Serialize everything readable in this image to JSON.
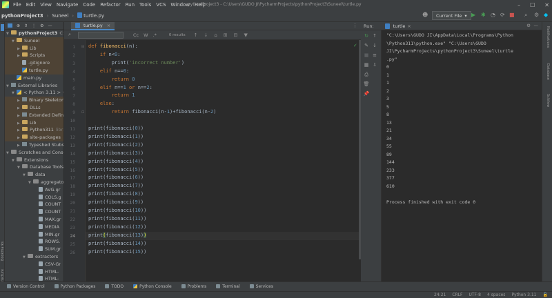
{
  "menu": [
    "File",
    "Edit",
    "View",
    "Navigate",
    "Code",
    "Refactor",
    "Run",
    "Tools",
    "VCS",
    "Window",
    "Help"
  ],
  "window_path": "pythonProject3 - C:\\Users\\GUDO JI\\PycharmProjects\\pythonProject3\\Suneel\\turtle.py",
  "breadcrumbs": [
    "pythonProject3",
    "Suneel",
    "turtle.py"
  ],
  "run_config": "Current File",
  "project_panel": {
    "label": "Project",
    "tree": [
      {
        "label": "pythonProject3",
        "suffix": "C:\\Use",
        "indent": 0,
        "arrow": "down",
        "icon": "folder",
        "bold": true
      },
      {
        "label": "Suneel",
        "indent": 1,
        "arrow": "down",
        "icon": "folder",
        "sel": true
      },
      {
        "label": "Lib",
        "indent": 2,
        "arrow": "right",
        "icon": "folder",
        "sel": true
      },
      {
        "label": "Scripts",
        "indent": 2,
        "arrow": "right",
        "icon": "folder",
        "sel": true
      },
      {
        "label": ".gitignore",
        "indent": 2,
        "arrow": "",
        "icon": "file",
        "sel": true
      },
      {
        "label": "turtle.py",
        "indent": 2,
        "arrow": "",
        "icon": "python",
        "sel": true
      },
      {
        "label": "main.py",
        "indent": 1,
        "arrow": "",
        "icon": "python"
      },
      {
        "label": "External Libraries",
        "indent": 0,
        "arrow": "down",
        "icon": "lib"
      },
      {
        "label": "< Python 3.11 >",
        "suffix": "C:\\",
        "indent": 1,
        "arrow": "down",
        "icon": "python"
      },
      {
        "label": "Binary Skeletons",
        "indent": 2,
        "arrow": "right",
        "icon": "lib",
        "sel": true
      },
      {
        "label": "DLLs",
        "indent": 2,
        "arrow": "right",
        "icon": "folder",
        "sel": true
      },
      {
        "label": "Extended Definiti",
        "indent": 2,
        "arrow": "right",
        "icon": "lib",
        "sel": true
      },
      {
        "label": "Lib",
        "indent": 2,
        "arrow": "right",
        "icon": "folder",
        "sel": true
      },
      {
        "label": "Python311",
        "suffix": "libra",
        "indent": 2,
        "arrow": "right",
        "icon": "folder",
        "sel": true
      },
      {
        "label": "site-packages",
        "indent": 2,
        "arrow": "right",
        "icon": "folder",
        "sel": true
      },
      {
        "label": "Typeshed Stubs",
        "indent": 2,
        "arrow": "right",
        "icon": "lib"
      },
      {
        "label": "Scratches and Consoles",
        "indent": 0,
        "arrow": "down",
        "icon": "grey"
      },
      {
        "label": "Extensions",
        "indent": 1,
        "arrow": "down",
        "icon": "grey"
      },
      {
        "label": "Database Tools a",
        "indent": 2,
        "arrow": "down",
        "icon": "grey"
      },
      {
        "label": "data",
        "indent": 3,
        "arrow": "down",
        "icon": "grey"
      },
      {
        "label": "aggregato",
        "indent": 4,
        "arrow": "down",
        "icon": "grey"
      },
      {
        "label": "AVG.gr",
        "indent": 5,
        "arrow": "",
        "icon": "file"
      },
      {
        "label": "COLS.g",
        "indent": 5,
        "arrow": "",
        "icon": "file"
      },
      {
        "label": "COUNT",
        "indent": 5,
        "arrow": "",
        "icon": "file"
      },
      {
        "label": "COUNT",
        "indent": 5,
        "arrow": "",
        "icon": "file"
      },
      {
        "label": "MAX.gr",
        "indent": 5,
        "arrow": "",
        "icon": "file"
      },
      {
        "label": "MEDIA",
        "indent": 5,
        "arrow": "",
        "icon": "file"
      },
      {
        "label": "MIN.gr",
        "indent": 5,
        "arrow": "",
        "icon": "file"
      },
      {
        "label": "ROWS.",
        "indent": 5,
        "arrow": "",
        "icon": "file"
      },
      {
        "label": "SUM.gr",
        "indent": 5,
        "arrow": "",
        "icon": "file"
      },
      {
        "label": "extractors",
        "indent": 3,
        "arrow": "down",
        "icon": "grey"
      },
      {
        "label": "CSV-Gr",
        "indent": 5,
        "arrow": "",
        "icon": "file"
      },
      {
        "label": "HTML-",
        "indent": 5,
        "arrow": "",
        "icon": "file"
      },
      {
        "label": "HTML-",
        "indent": 5,
        "arrow": "",
        "icon": "file"
      },
      {
        "label": "JSON-",
        "indent": 5,
        "arrow": "",
        "icon": "file"
      }
    ]
  },
  "editor": {
    "tab_label": "turtle.py",
    "find_results": "0 results",
    "find_toggles": [
      "Cc",
      "W",
      ".*"
    ],
    "current_line": 24,
    "lines": [
      [
        [
          "kw",
          "def "
        ],
        [
          "fn",
          "fibonacci"
        ],
        [
          "",
          "(n):"
        ]
      ],
      [
        [
          "",
          "    "
        ],
        [
          "kw",
          "if "
        ],
        [
          "",
          "n<"
        ],
        [
          "num",
          "0"
        ],
        [
          "",
          ":"
        ]
      ],
      [
        [
          "",
          "        print("
        ],
        [
          "str",
          "'incorrect number'"
        ],
        [
          "",
          ")"
        ]
      ],
      [
        [
          "",
          "    "
        ],
        [
          "kw",
          "elif "
        ],
        [
          "",
          "n=="
        ],
        [
          "num",
          "0"
        ],
        [
          "",
          ":"
        ]
      ],
      [
        [
          "",
          "        "
        ],
        [
          "kw",
          "return "
        ],
        [
          "num",
          "0"
        ]
      ],
      [
        [
          "",
          "    "
        ],
        [
          "kw",
          "elif "
        ],
        [
          "",
          "n=="
        ],
        [
          "num",
          "1 "
        ],
        [
          "kw",
          "or "
        ],
        [
          "",
          "n=="
        ],
        [
          "num",
          "2"
        ],
        [
          "",
          ":"
        ]
      ],
      [
        [
          "",
          "        "
        ],
        [
          "kw",
          "return "
        ],
        [
          "num",
          "1"
        ]
      ],
      [
        [
          "",
          "    "
        ],
        [
          "kw",
          "else"
        ],
        [
          "",
          ":"
        ]
      ],
      [
        [
          "",
          "        "
        ],
        [
          "kw",
          "return "
        ],
        [
          "",
          "fibonacci(n-"
        ],
        [
          "num",
          "1"
        ],
        [
          "",
          ")+fibonacci(n-"
        ],
        [
          "num",
          "2"
        ],
        [
          "",
          ")"
        ]
      ],
      [],
      [
        [
          "",
          "print(fibonacci("
        ],
        [
          "num",
          "0"
        ],
        [
          "",
          "))"
        ]
      ],
      [
        [
          "",
          "print(fibonacci("
        ],
        [
          "num",
          "1"
        ],
        [
          "",
          "))"
        ]
      ],
      [
        [
          "",
          "print(fibonacci("
        ],
        [
          "num",
          "2"
        ],
        [
          "",
          "))"
        ]
      ],
      [
        [
          "",
          "print(fibonacci("
        ],
        [
          "num",
          "3"
        ],
        [
          "",
          "))"
        ]
      ],
      [
        [
          "",
          "print(fibonacci("
        ],
        [
          "num",
          "4"
        ],
        [
          "",
          "))"
        ]
      ],
      [
        [
          "",
          "print(fibonacci("
        ],
        [
          "num",
          "5"
        ],
        [
          "",
          "))"
        ]
      ],
      [
        [
          "",
          "print(fibonacci("
        ],
        [
          "num",
          "6"
        ],
        [
          "",
          "))"
        ]
      ],
      [
        [
          "",
          "print(fibonacci("
        ],
        [
          "num",
          "7"
        ],
        [
          "",
          "))"
        ]
      ],
      [
        [
          "",
          "print(fibonacci("
        ],
        [
          "num",
          "8"
        ],
        [
          "",
          "))"
        ]
      ],
      [
        [
          "",
          "print(fibonacci("
        ],
        [
          "num",
          "9"
        ],
        [
          "",
          "))"
        ]
      ],
      [
        [
          "",
          "print(fibonacci("
        ],
        [
          "num",
          "10"
        ],
        [
          "",
          "))"
        ]
      ],
      [
        [
          "",
          "print(fibonacci("
        ],
        [
          "num",
          "11"
        ],
        [
          "",
          "))"
        ]
      ],
      [
        [
          "",
          "print(fibonacci("
        ],
        [
          "num",
          "12"
        ],
        [
          "",
          "))"
        ]
      ],
      [
        [
          "",
          "print"
        ],
        [
          "brk",
          "("
        ],
        [
          "",
          "fibonacci("
        ],
        [
          "num",
          "13"
        ],
        [
          "",
          ")"
        ],
        [
          "brk",
          ")"
        ]
      ],
      [
        [
          "",
          "print(fibonacci("
        ],
        [
          "num",
          "14"
        ],
        [
          "",
          "))"
        ]
      ],
      [
        [
          "",
          "print(fibonacci("
        ],
        [
          "num",
          "15"
        ],
        [
          "",
          "))"
        ]
      ]
    ]
  },
  "run_panel": {
    "label": "Run:",
    "tab_label": "turtle",
    "output": [
      "\"C:\\Users\\GUDO JI\\AppData\\Local\\Programs\\Python",
      "\\Python311\\python.exe\" \"C:\\Users\\GUDO",
      "JI\\PycharmProjects\\pythonProject3\\Suneel\\turtle",
      ".py\"",
      "0",
      "1",
      "1",
      "2",
      "3",
      "5",
      "8",
      "13",
      "21",
      "34",
      "55",
      "89",
      "144",
      "233",
      "377",
      "610",
      "",
      "Process finished with exit code 0"
    ]
  },
  "right_stripe": [
    "Notifications",
    "Database",
    "SciView"
  ],
  "left_stripe": [
    "Bookmarks",
    "Structure"
  ],
  "bottom_tabs": [
    "Version Control",
    "Python Packages",
    "TODO",
    "Python Console",
    "Problems",
    "Terminal",
    "Services"
  ],
  "status": [
    "24:21",
    "CRLF",
    "UTF-8",
    "4 spaces",
    "Python 3.11"
  ],
  "colors": {
    "accent": "#4a88c7",
    "selection": "#4e4335",
    "keyword": "#cc7832",
    "function": "#ffc66d",
    "string": "#6a8759",
    "number": "#6897bb"
  }
}
